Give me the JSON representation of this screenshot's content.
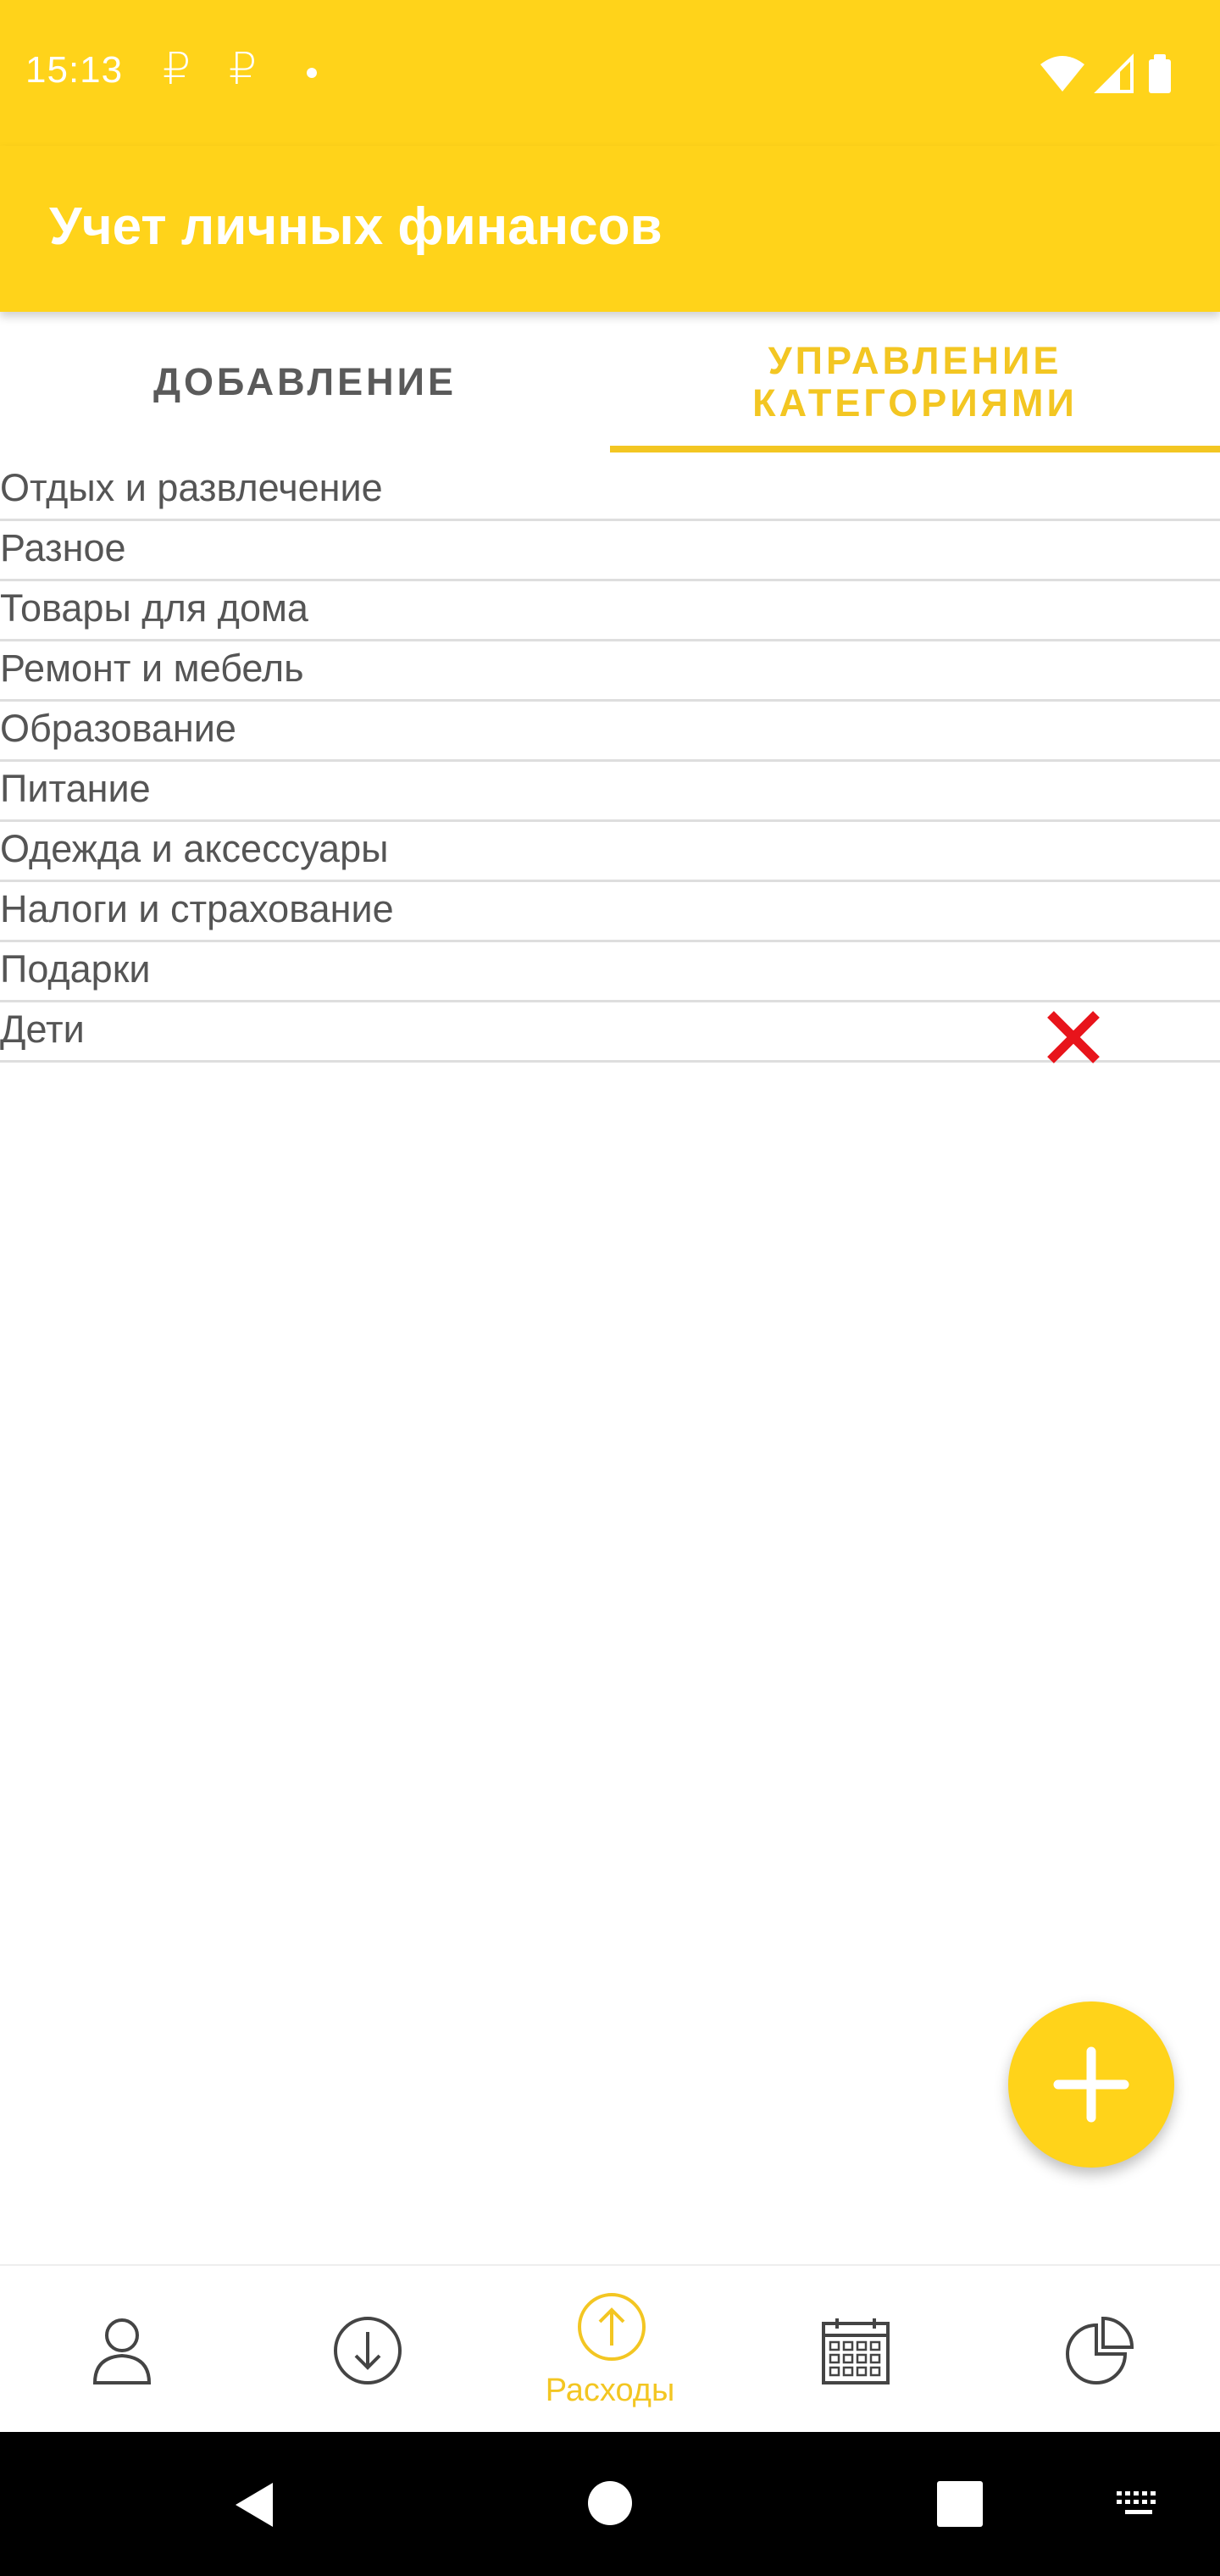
{
  "status_bar": {
    "time": "15:13",
    "notif_symbols": [
      "₽",
      "₽"
    ]
  },
  "app": {
    "title": "Учет личных финансов"
  },
  "tabs": [
    {
      "label": "ДОБАВЛЕНИЕ",
      "active": false
    },
    {
      "label": "УПРАВЛЕНИЕ КАТЕГОРИЯМИ",
      "active": true
    }
  ],
  "categories": [
    "Отдых и развлечение",
    "Разное",
    "Товары для дома",
    "Ремонт и мебель",
    "Образование",
    "Питание",
    "Одежда и аксессуары",
    "Налоги и страхование",
    "Подарки",
    "Дети"
  ],
  "bottom_nav": {
    "items": [
      {
        "icon": "person-icon"
      },
      {
        "icon": "income-down-arrow-icon"
      },
      {
        "icon": "expense-up-arrow-icon",
        "label": "Расходы",
        "active": true
      },
      {
        "icon": "calendar-icon"
      },
      {
        "icon": "pie-chart-icon"
      }
    ]
  },
  "colors": {
    "accent": "#FFD31A",
    "accent_text": "#F3C622",
    "delete": "#E8141B",
    "text": "#555555"
  }
}
